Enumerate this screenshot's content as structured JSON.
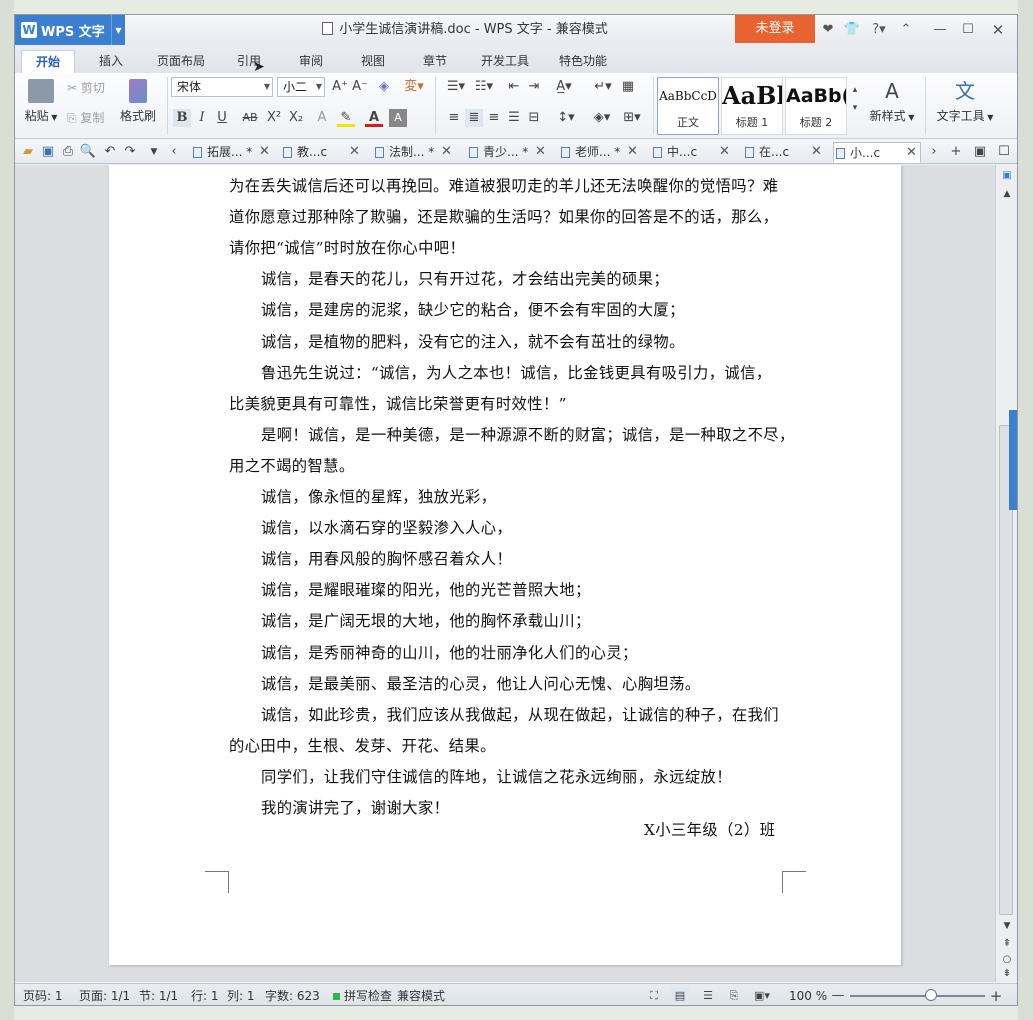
{
  "app": {
    "name": "WPS 文字",
    "window_title": "小学生诚信演讲稿.doc - WPS 文字 - 兼容模式",
    "login_label": "未登录"
  },
  "menu_tabs": [
    "开始",
    "插入",
    "页面布局",
    "引用",
    "审阅",
    "视图",
    "章节",
    "开发工具",
    "特色功能"
  ],
  "ribbon": {
    "paste": "粘贴",
    "cut": "剪切",
    "copy": "复制",
    "format_painter": "格式刷",
    "font_name": "宋体",
    "font_size": "小二",
    "styles": [
      {
        "preview": "AaBbCcD",
        "name": "正文"
      },
      {
        "preview": "AaBl",
        "name": "标题 1"
      },
      {
        "preview": "AaBb(",
        "name": "标题 2"
      }
    ],
    "new_style": "新样式",
    "text_tools": "文字工具"
  },
  "doc_tabs": [
    "拓展... *",
    "教...c",
    "法制... *",
    "青少... *",
    "老师... *",
    "中...c",
    "在...c",
    "小...c"
  ],
  "document_lines": [
    {
      "indent": false,
      "text": "为在丢失诚信后还可以再挽回。难道被狠叨走的羊儿还无法唤醒你的觉悟吗？难"
    },
    {
      "indent": false,
      "text": "道你愿意过那种除了欺骗，还是欺骗的生活吗？如果你的回答是不的话，那么，"
    },
    {
      "indent": false,
      "text": "请你把“诚信”时时放在你心中吧！"
    },
    {
      "indent": true,
      "text": "诚信，是春天的花儿，只有开过花，才会结出完美的硕果；"
    },
    {
      "indent": true,
      "text": "诚信，是建房的泥浆，缺少它的粘合，便不会有牢固的大厦；"
    },
    {
      "indent": true,
      "text": "诚信，是植物的肥料，没有它的注入，就不会有茁壮的绿物。"
    },
    {
      "indent": true,
      "text": "鲁迅先生说过：“诚信，为人之本也！诚信，比金钱更具有吸引力，诚信，"
    },
    {
      "indent": false,
      "text": "比美貌更具有可靠性，诚信比荣誉更有时效性！”"
    },
    {
      "indent": true,
      "text": "是啊！诚信，是一种美德，是一种源源不断的财富；诚信，是一种取之不尽，"
    },
    {
      "indent": false,
      "text": "用之不竭的智慧。"
    },
    {
      "indent": true,
      "text": "诚信，像永恒的星辉，独放光彩，"
    },
    {
      "indent": true,
      "text": "诚信，以水滴石穿的坚毅渗入人心，"
    },
    {
      "indent": true,
      "text": "诚信，用春风般的胸怀感召着众人！"
    },
    {
      "indent": true,
      "text": "诚信，是耀眼璀璨的阳光，他的光芒普照大地；"
    },
    {
      "indent": true,
      "text": "诚信，是广阔无垠的大地，他的胸怀承载山川；"
    },
    {
      "indent": true,
      "text": "诚信，是秀丽神奇的山川，他的壮丽净化人们的心灵；"
    },
    {
      "indent": true,
      "text": "诚信，是最美丽、最圣洁的心灵，他让人问心无愧、心胸坦荡。"
    },
    {
      "indent": true,
      "text": "诚信，如此珍贵，我们应该从我做起，从现在做起，让诚信的种子，在我们"
    },
    {
      "indent": false,
      "text": "的心田中，生根、发芽、开花、结果。"
    },
    {
      "indent": true,
      "text": "同学们，让我们守住诚信的阵地，让诚信之花永远绚丽，永远绽放！"
    },
    {
      "indent": true,
      "text": "我的演讲完了，谢谢大家！"
    }
  ],
  "signature": "X小三年级（2）班",
  "status": {
    "page_code": "页码: 1",
    "pages": "页面: 1/1",
    "section": "节: 1/1",
    "row": "行: 1",
    "col": "列: 1",
    "word_count": "字数: 623",
    "spell_check": "拼写检查",
    "compat_mode": "兼容模式",
    "zoom": "100 %",
    "zoom_level": 0.6
  },
  "colors": {
    "accent": "#3a7fd0",
    "login": "#e8632f",
    "spell_ok": "#2db84a"
  }
}
